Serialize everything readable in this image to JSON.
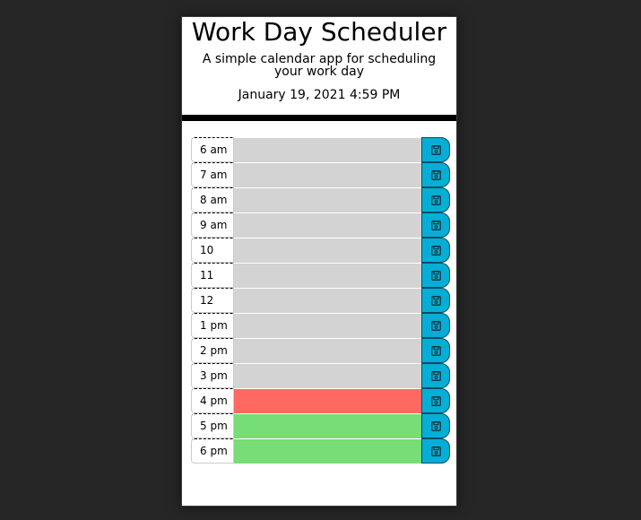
{
  "header": {
    "title": "Work Day Scheduler",
    "lead": "A simple calendar app for scheduling your work day",
    "current_date": "January 19, 2021 4:59 PM"
  },
  "rows": [
    {
      "hour": "6 am",
      "status": "past",
      "text": ""
    },
    {
      "hour": "7 am",
      "status": "past",
      "text": ""
    },
    {
      "hour": "8 am",
      "status": "past",
      "text": ""
    },
    {
      "hour": "9 am",
      "status": "past",
      "text": ""
    },
    {
      "hour": "10 am",
      "status": "past",
      "text": ""
    },
    {
      "hour": "11 am",
      "status": "past",
      "text": ""
    },
    {
      "hour": "12 pm",
      "status": "past",
      "text": ""
    },
    {
      "hour": "1 pm",
      "status": "past",
      "text": ""
    },
    {
      "hour": "2 pm",
      "status": "past",
      "text": ""
    },
    {
      "hour": "3 pm",
      "status": "past",
      "text": ""
    },
    {
      "hour": "4 pm",
      "status": "present",
      "text": ""
    },
    {
      "hour": "5 pm",
      "status": "future",
      "text": ""
    },
    {
      "hour": "6 pm",
      "status": "future",
      "text": ""
    }
  ],
  "icons": {
    "save": "save-icon"
  },
  "colors": {
    "past": "#d3d3d3",
    "present": "#ff6961",
    "future": "#77dd77",
    "save_button": "#06aed5"
  }
}
